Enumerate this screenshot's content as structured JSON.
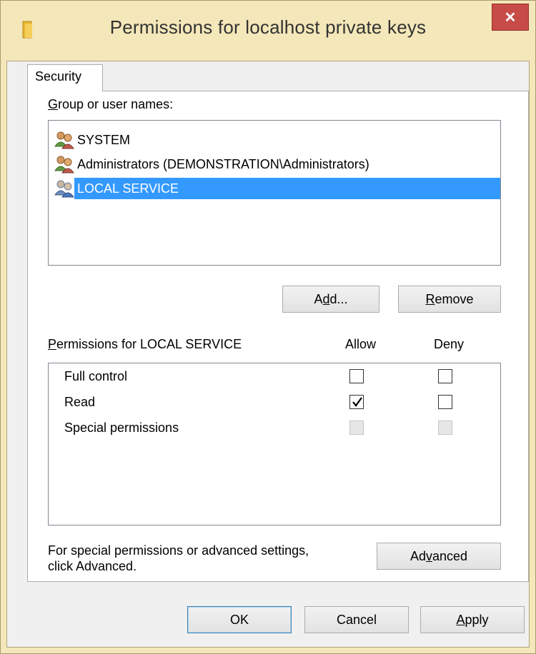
{
  "window": {
    "title": "Permissions for localhost private keys",
    "close_glyph": "✕",
    "title_icon": "folder-icon",
    "frame_color": "#f4e7b9",
    "close_color": "#c74b47"
  },
  "tabs": [
    {
      "label": "Security",
      "selected": true
    }
  ],
  "group_label": {
    "prefix": "G",
    "rest": "roup or user names:"
  },
  "users": [
    {
      "name": "SYSTEM",
      "icon": "users-icon",
      "selected": false
    },
    {
      "name": "Administrators (DEMONSTRATION\\Administrators)",
      "icon": "users-icon",
      "selected": false
    },
    {
      "name": "LOCAL SERVICE",
      "icon": "users-icon",
      "selected": true
    }
  ],
  "buttons": {
    "add": {
      "pre": "A",
      "key": "d",
      "post": "d..."
    },
    "remove": {
      "pre": "",
      "key": "R",
      "post": "emove"
    },
    "advanced": {
      "pre": "Ad",
      "key": "v",
      "post": "anced"
    },
    "ok": "OK",
    "cancel": "Cancel",
    "apply": {
      "pre": "",
      "key": "A",
      "post": "pply"
    }
  },
  "permissions": {
    "label_prefix": "P",
    "label_rest": "ermissions for LOCAL SERVICE",
    "allow_header": "Allow",
    "deny_header": "Deny",
    "rows": [
      {
        "name": "Full control",
        "allow": false,
        "deny": false,
        "enabled": true
      },
      {
        "name": "Read",
        "allow": true,
        "deny": false,
        "enabled": true
      },
      {
        "name": "Special permissions",
        "allow": false,
        "deny": false,
        "enabled": false
      }
    ]
  },
  "advanced_note": {
    "line1": "For special permissions or advanced settings,",
    "line2": "click Advanced."
  },
  "colors": {
    "selection": "#3399ff",
    "panel": "#ffffff",
    "dialog": "#f0f0f0"
  }
}
